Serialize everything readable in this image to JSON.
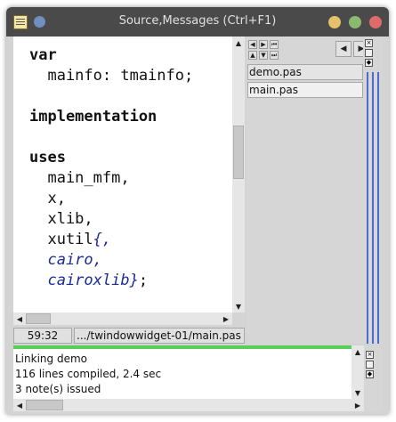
{
  "window": {
    "title": "Source,Messages (Ctrl+F1)",
    "colors": {
      "titlebar": "#4a4a4a",
      "min": "#e6c06a",
      "max": "#8db872",
      "close": "#e06a6a",
      "accent": "#4b6bd0",
      "comment": "#1a2b9a",
      "progress": "#58d058"
    }
  },
  "editor": {
    "lines": [
      {
        "kw": "var"
      },
      {
        "text": "  mainfo: tmainfo;"
      },
      {
        "kw": "implementation"
      },
      {
        "kw": "uses"
      },
      {
        "text": "  main_mfm,"
      },
      {
        "text": "  x,"
      },
      {
        "text": "  xlib,"
      },
      {
        "text": "  xutil",
        "comment": "{,"
      },
      {
        "comment": "  cairo,"
      },
      {
        "comment": "  cairoxlib}",
        "text": ";"
      }
    ]
  },
  "status": {
    "cursor": "59:32",
    "file": ".../twindowwidget-01/main.pas"
  },
  "files": {
    "items": [
      "demo.pas",
      "main.pas"
    ]
  },
  "messages": {
    "lines": [
      "Linking demo",
      "116 lines compiled, 2.4 sec",
      "3 note(s) issued"
    ]
  },
  "icons": {
    "app": "document-icon",
    "up": "arrow-up-icon",
    "down": "arrow-down-icon",
    "left": "arrow-left-icon",
    "right": "arrow-right-icon"
  }
}
